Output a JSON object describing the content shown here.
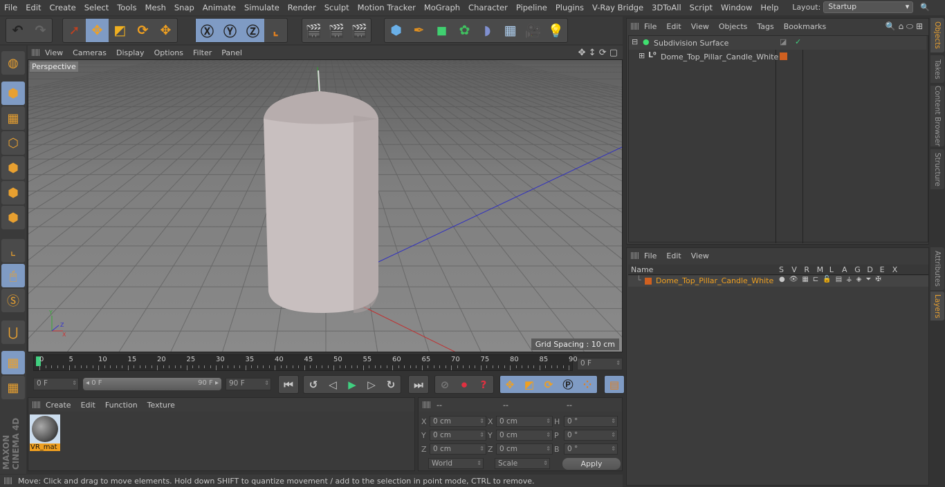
{
  "menu": [
    "File",
    "Edit",
    "Create",
    "Select",
    "Tools",
    "Mesh",
    "Snap",
    "Animate",
    "Simulate",
    "Render",
    "Sculpt",
    "Motion Tracker",
    "MoGraph",
    "Character",
    "Pipeline",
    "Plugins",
    "V-Ray Bridge",
    "3DToAll",
    "Script",
    "Window",
    "Help"
  ],
  "layout": {
    "label": "Layout:",
    "value": "Startup"
  },
  "toolbar": [
    {
      "icons": [
        {
          "n": "undo-icon",
          "g": "↶",
          "c": "#222"
        },
        {
          "n": "redo-icon",
          "g": "↷",
          "c": "#666"
        }
      ]
    },
    {
      "icons": [
        {
          "n": "select-arrow-icon",
          "g": "➚",
          "c": "#c04020"
        },
        {
          "n": "move-icon",
          "g": "✥",
          "c": "#f0a020",
          "a": 1
        },
        {
          "n": "scale-icon",
          "g": "◩",
          "c": "#f0b020"
        },
        {
          "n": "rotate-icon",
          "g": "⟳",
          "c": "#f0a020"
        },
        {
          "n": "transform-icon",
          "g": "✥",
          "c": "#f0a020"
        }
      ]
    },
    {
      "icons": [
        {
          "n": "x-axis-icon",
          "g": "Ⓧ",
          "c": "#222",
          "a": 1
        },
        {
          "n": "y-axis-icon",
          "g": "Ⓨ",
          "c": "#222",
          "a": 1
        },
        {
          "n": "z-axis-icon",
          "g": "Ⓩ",
          "c": "#222",
          "a": 1
        },
        {
          "n": "coordinate-system-icon",
          "g": "⌞",
          "c": "#e08020"
        }
      ]
    },
    {
      "icons": [
        {
          "n": "render-view-icon",
          "g": "🎬",
          "c": "#eee"
        },
        {
          "n": "render-picture-viewer-icon",
          "g": "🎬",
          "c": "#e05020"
        },
        {
          "n": "render-settings-icon",
          "g": "🎬",
          "c": "#e05020"
        }
      ]
    },
    {
      "icons": [
        {
          "n": "cube-icon",
          "g": "⬢",
          "c": "#6ab0e8"
        },
        {
          "n": "pen-spline-icon",
          "g": "✒",
          "c": "#e09020"
        },
        {
          "n": "subdivision-icon",
          "g": "◼",
          "c": "#40d070"
        },
        {
          "n": "mograph-cloner-icon",
          "g": "✿",
          "c": "#40c060"
        },
        {
          "n": "deformer-icon",
          "g": "◗",
          "c": "#8090d0"
        },
        {
          "n": "floor-icon",
          "g": "▦",
          "c": "#b0d0f0"
        },
        {
          "n": "camera-icon",
          "g": "🎥",
          "c": "#eee"
        },
        {
          "n": "light-icon",
          "g": "💡",
          "c": "#eee"
        }
      ]
    }
  ],
  "left_tools": [
    "make-editable-icon",
    "model-mode-icon",
    "texture-mode-icon",
    "workplane-icon",
    "points-mode-icon",
    "edges-mode-icon",
    "polygons-mode-icon",
    "axis-mode-icon",
    "tweak-mode-icon",
    "solo-icon",
    "snap-magnet-icon",
    "lock-workplane-icon",
    "workplane-snap-icon"
  ],
  "viewport": {
    "menu": [
      "View",
      "Cameras",
      "Display",
      "Options",
      "Filter",
      "Panel"
    ],
    "label": "Perspective",
    "grid_spacing": "Grid Spacing : 10 cm"
  },
  "timeline": {
    "ticks": [
      "0",
      "5",
      "10",
      "15",
      "20",
      "25",
      "30",
      "35",
      "40",
      "45",
      "50",
      "55",
      "60",
      "65",
      "70",
      "75",
      "80",
      "85",
      "90"
    ],
    "current": "0 F",
    "start": "0 F",
    "range_start": "0 F",
    "range_end": "90 F",
    "end": "90 F"
  },
  "materials": {
    "menu": [
      "Create",
      "Edit",
      "Function",
      "Texture"
    ],
    "items": [
      {
        "name": "VR_mat"
      }
    ]
  },
  "coords": {
    "headers": [
      "--",
      "--",
      "--"
    ],
    "rows": [
      {
        "a": "X",
        "av": "0 cm",
        "b": "X",
        "bv": "0 cm",
        "c": "H",
        "cv": "0 °"
      },
      {
        "a": "Y",
        "av": "0 cm",
        "b": "Y",
        "bv": "0 cm",
        "c": "P",
        "cv": "0 °"
      },
      {
        "a": "Z",
        "av": "0 cm",
        "b": "Z",
        "bv": "0 cm",
        "c": "B",
        "cv": "0 °"
      }
    ],
    "mode": "World",
    "size_mode": "Scale",
    "apply": "Apply"
  },
  "status": "Move: Click and drag to move elements. Hold down SHIFT to quantize movement / add to the selection in point mode, CTRL to remove.",
  "objects": {
    "menu": [
      "File",
      "Edit",
      "View",
      "Objects",
      "Tags",
      "Bookmarks"
    ],
    "items": [
      {
        "name": "Subdivision Surface"
      },
      {
        "name": "Dome_Top_Pillar_Candle_White"
      }
    ]
  },
  "layers": {
    "menu": [
      "File",
      "Edit",
      "View"
    ],
    "columns": [
      "Name",
      "S",
      "V",
      "R",
      "M",
      "L",
      "A",
      "G",
      "D",
      "E",
      "X"
    ],
    "rows": [
      {
        "name": "Dome_Top_Pillar_Candle_White",
        "color": "#d06020"
      }
    ]
  },
  "side_tabs": [
    "Objects",
    "Takes",
    "Content Browser",
    "Structure",
    "Attributes",
    "Layers"
  ],
  "brand": "MAXON CINEMA 4D",
  "colors": {
    "accent": "#f0a020",
    "selected_tab": "#e8a030",
    "active_button": "#7f9bc4"
  }
}
